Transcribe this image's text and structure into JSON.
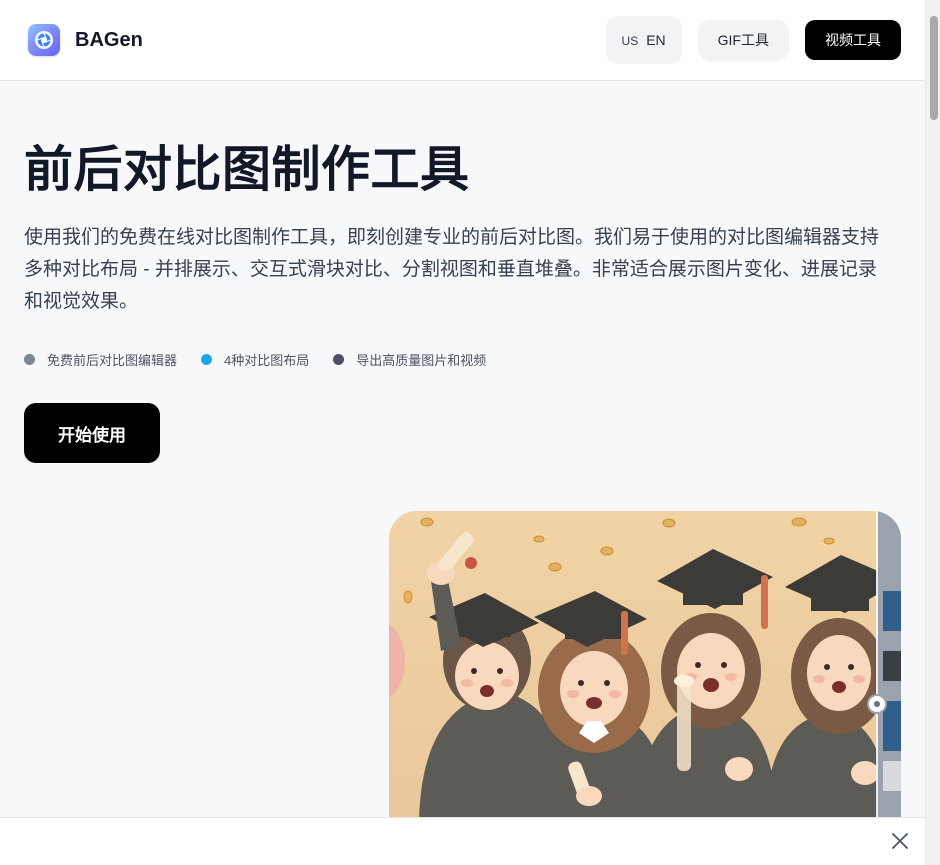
{
  "header": {
    "brand": "BAGen",
    "lang_flag": "US",
    "lang_label": "EN",
    "gif_tool": "GIF工具",
    "video_tool": "视频工具"
  },
  "hero": {
    "title": "前后对比图制作工具",
    "description": "使用我们的免费在线对比图制作工具，即刻创建专业的前后对比图。我们易于使用的对比图编辑器支持多种对比布局 - 并排展示、交互式滑块对比、分割视图和垂直堆叠。非常适合展示图片变化、进展记录和视觉效果。",
    "features": [
      {
        "label": "免费前后对比图编辑器",
        "color": "#7b8794"
      },
      {
        "label": "4种对比图布局",
        "color": "#1ea7e8"
      },
      {
        "label": "导出高质量图片和视频",
        "color": "#4b5068"
      }
    ],
    "cta": "开始使用"
  },
  "colors": {
    "accent": "#000000",
    "page_bg": "#f7f8fa"
  },
  "icons": {
    "logo": "camera-aperture-icon",
    "close": "close-icon"
  }
}
